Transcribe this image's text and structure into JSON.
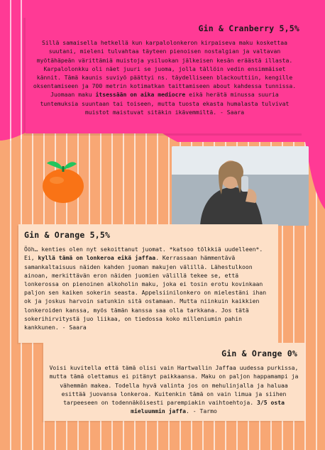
{
  "colors": {
    "background": "#f8a774",
    "pink": "#ff3a95",
    "card": "#fde0c8",
    "orange": "#f97316"
  },
  "reviews": [
    {
      "title": "Gin & Cranberry 5,5%",
      "text_before": "Sillä samaisella hetkellä kun karpalolonkeron kirpaiseva maku koskettaa suutani, mieleni tulvahtaa täyteen pienoisen nostalgian ja valtavan myötähäpeän värittämiä muistoja ysiluokan jälkeisen kesän eräästä illasta. Karpalolonkku oli näet juuri se juoma, jolla tällöin vedin ensimmäiset kännit. Tämä kaunis suviyö päättyi ns. täydelliseen blackouttiin, kengille oksentamiseen ja 700 metrin kotimatkan taittamiseen about kahdessa tunnissa. Juomaan maku ",
      "text_bold": "itsessään on aika mediocre",
      "text_after": " eikä herätä minussa suuria tuntemuksia suuntaan tai toiseen, mutta tuosta ekasta humalasta tulvivat muistot maistuvat sitäkin ikävemmiltä. - Saara"
    },
    {
      "title": "Gin & Orange 5,5%",
      "text_before": "Ööh… kenties olen nyt sekoittanut juomat. *katsoo tölkkiä uudelleen*. Ei, ",
      "text_bold": "kyllä tämä on lonkeroa eikä jaffaa",
      "text_after": ". Kerrassaan hämmentävä samankaltaisuus näiden kahden juoman makujen välillä. Lähestulkoon ainoan, merkittävän eron näiden juomien välillä tekee se, että lonkerossa on pienoinen alkoholin maku, joka ei tosin erotu kovinkaan paljon sen kaiken sokerin seasta. Appelsiinilonkero on mielestäni ihan ok ja joskus harvoin satunkin sitä ostamaan. Mutta niinkuin kaikkien lonkeroiden kanssa, myös tämän kanssa saa olla tarkkana. Jos tätä sokerihirvitystä juo liikaa, on tiedossa koko milleniumin pahin kankkunen. - Saara"
    },
    {
      "title": "Gin & Orange 0%",
      "text_before": "Voisi kuvitella että tämä olisi vain Hartwallin Jaffaa uudessa purkissa, mutta tämä olettamus ei pitänyt paikkaansa. Maku on paljon happamampi ja vähemmän makea. Todella hyvä valinta jos on mehulinjalla ja haluaa esittää juovansa lonkeroa. Kuitenkin tämä on vain limua ja siihen tarpeeseen on todennäköisesti parempiakin vaihtoehtoja. ",
      "text_bold": "3/5 osta mieluummin jaffa",
      "text_after": ". - Tarmo"
    }
  ]
}
